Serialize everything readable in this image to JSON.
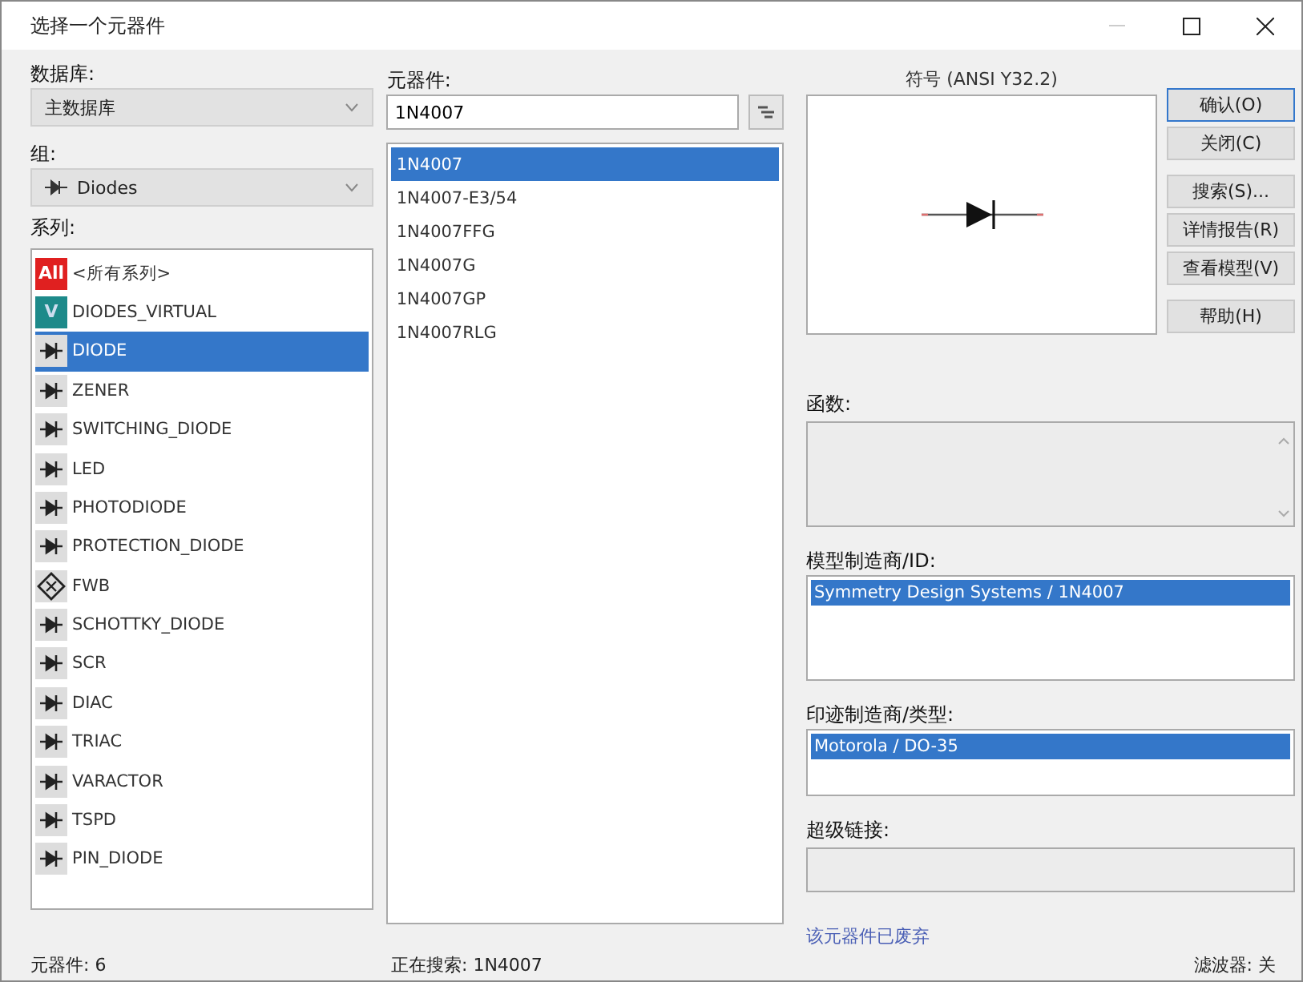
{
  "window": {
    "title": "选择一个元器件"
  },
  "database": {
    "label": "数据库:",
    "value": "主数据库"
  },
  "group": {
    "label": "组:",
    "value": "Diodes"
  },
  "series": {
    "label": "系列:",
    "items": [
      {
        "kind": "all",
        "badge": "All",
        "label": "<所有系列>",
        "selected": false
      },
      {
        "kind": "virtual",
        "badge": "V",
        "label": "DIODES_VIRTUAL",
        "selected": false
      },
      {
        "kind": "symbol",
        "label": "DIODE",
        "selected": true
      },
      {
        "kind": "symbol",
        "label": "ZENER",
        "selected": false
      },
      {
        "kind": "symbol",
        "label": "SWITCHING_DIODE",
        "selected": false
      },
      {
        "kind": "symbol",
        "label": "LED",
        "selected": false
      },
      {
        "kind": "symbol",
        "label": "PHOTODIODE",
        "selected": false
      },
      {
        "kind": "symbol",
        "label": "PROTECTION_DIODE",
        "selected": false
      },
      {
        "kind": "bridge",
        "label": "FWB",
        "selected": false
      },
      {
        "kind": "symbol",
        "label": "SCHOTTKY_DIODE",
        "selected": false
      },
      {
        "kind": "symbol",
        "label": "SCR",
        "selected": false
      },
      {
        "kind": "symbol",
        "label": "DIAC",
        "selected": false
      },
      {
        "kind": "symbol",
        "label": "TRIAC",
        "selected": false
      },
      {
        "kind": "symbol",
        "label": "VARACTOR",
        "selected": false
      },
      {
        "kind": "symbol",
        "label": "TSPD",
        "selected": false
      },
      {
        "kind": "symbol",
        "label": "PIN_DIODE",
        "selected": false
      }
    ]
  },
  "component": {
    "label": "元器件:",
    "value": "1N4007",
    "items": [
      {
        "label": "1N4007",
        "selected": true
      },
      {
        "label": "1N4007-E3/54",
        "selected": false
      },
      {
        "label": "1N4007FFG",
        "selected": false
      },
      {
        "label": "1N4007G",
        "selected": false
      },
      {
        "label": "1N4007GP",
        "selected": false
      },
      {
        "label": "1N4007RLG",
        "selected": false
      }
    ]
  },
  "symbol": {
    "label": "符号 (ANSI Y32.2)"
  },
  "buttons": [
    {
      "label": "确认(O)",
      "selected": true
    },
    {
      "label": "关闭(C)",
      "selected": false
    },
    {
      "label": "搜索(S)...",
      "selected": false
    },
    {
      "label": "详情报告(R)",
      "selected": false
    },
    {
      "label": "查看模型(V)",
      "selected": false
    },
    {
      "label": "帮助(H)",
      "selected": false
    }
  ],
  "function": {
    "label": "函数:"
  },
  "model_manufacturer": {
    "label": "模型制造商/ID:",
    "items": [
      {
        "label": "Symmetry Design Systems / 1N4007",
        "selected": true
      }
    ]
  },
  "footprint_manufacturer": {
    "label": "印迹制造商/类型:",
    "items": [
      {
        "label": "Motorola / DO-35",
        "selected": true
      }
    ]
  },
  "hyperlink": {
    "label": "超级链接:"
  },
  "obsolete_link": "该元器件已废弃",
  "status_bar": {
    "count": "元器件: 6",
    "searching": "正在搜索: 1N4007",
    "filter": "滤波器: 关"
  }
}
